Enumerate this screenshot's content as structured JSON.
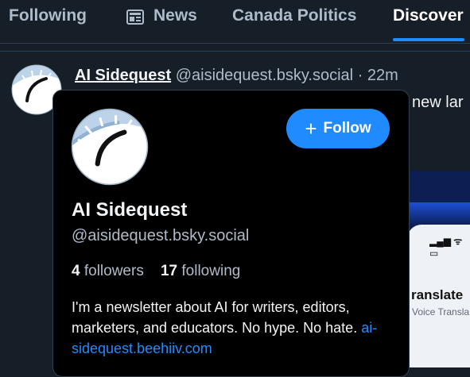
{
  "tabs": [
    {
      "label": "Following",
      "active": false
    },
    {
      "label": "News",
      "active": false,
      "icon": "newspaper-icon"
    },
    {
      "label": "Canada Politics",
      "active": false
    },
    {
      "label": "Discover",
      "active": true
    }
  ],
  "colors": {
    "accent": "#208bfe",
    "background": "#161e27",
    "card_bg": "#000000"
  },
  "post": {
    "author_name": "AI Sidequest",
    "author_handle": "@aisidequest.bsky.social",
    "separator": "·",
    "time": "22m",
    "snippet": "new lar"
  },
  "embed": {
    "title_partial": "ranslate",
    "subtitle_partial": "Voice Transla"
  },
  "hover_card": {
    "follow_label": "Follow",
    "name": "AI Sidequest",
    "handle": "@aisidequest.bsky.social",
    "followers_count": "4",
    "followers_label": "followers",
    "following_count": "17",
    "following_label": "following",
    "bio_text": "I'm a newsletter about AI for writers, editors, marketers, and educators. No hype. No hate. ",
    "bio_link": "ai-sidequest.beehiiv.com"
  }
}
